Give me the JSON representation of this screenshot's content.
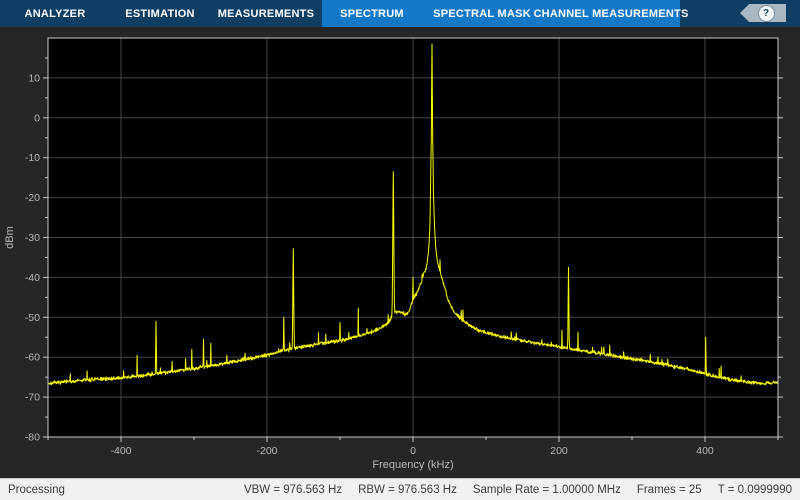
{
  "toolbar": {
    "tabs": [
      {
        "label": "ANALYZER",
        "selected": false
      },
      {
        "label": "ESTIMATION",
        "selected": false
      },
      {
        "label": "MEASUREMENTS",
        "selected": false
      },
      {
        "label": "SPECTRUM",
        "selected": true
      },
      {
        "label": "SPECTRAL MASK",
        "selected": true
      },
      {
        "label": "CHANNEL MEASUREMENTS",
        "selected": true
      }
    ],
    "help_icon_glyph": "?"
  },
  "statusbar": {
    "left": "Processing",
    "metrics": [
      "VBW = 976.563 Hz",
      "RBW = 976.563 Hz",
      "Sample Rate = 1.00000 MHz",
      "Frames = 25",
      "T = 0.0999990"
    ]
  },
  "colors": {
    "accent_dark": "#0e3e64",
    "accent_light": "#1478c8",
    "figure_bg": "#262626",
    "plot_bg": "#000000",
    "grid": "#464646",
    "axis_line": "#c8c8c8",
    "tick_text": "#b8b8b8",
    "trace": "#ffff00",
    "statusbar_bg": "#f0f0f0"
  },
  "chart_data": {
    "type": "line",
    "title": "",
    "xlabel": "Frequency (kHz)",
    "ylabel": "dBm",
    "xlim": [
      -500,
      500
    ],
    "ylim": [
      -80,
      20
    ],
    "xticks_labeled": [
      -400,
      -200,
      0,
      200,
      400
    ],
    "xtick_minor_step_khz": 100,
    "yticks_labeled": [
      -80,
      -70,
      -60,
      -50,
      -40,
      -30,
      -20,
      -10,
      0,
      10
    ],
    "ytick_minor_step_db": 5,
    "grid": true,
    "legend": "none",
    "noise_jitter_db": 0.7,
    "floor_points": [
      [
        -500,
        -66.6
      ],
      [
        -480,
        -66.2
      ],
      [
        -460,
        -65.9
      ],
      [
        -440,
        -65.6
      ],
      [
        -420,
        -65.4
      ],
      [
        -400,
        -65.2
      ],
      [
        -380,
        -64.8
      ],
      [
        -360,
        -64.3
      ],
      [
        -340,
        -63.8
      ],
      [
        -320,
        -63.3
      ],
      [
        -300,
        -62.8
      ],
      [
        -280,
        -62.2
      ],
      [
        -260,
        -61.6
      ],
      [
        -240,
        -60.9
      ],
      [
        -220,
        -60.2
      ],
      [
        -200,
        -59.4
      ],
      [
        -185,
        -58.7
      ],
      [
        -170,
        -58.1
      ],
      [
        -155,
        -57.5
      ],
      [
        -140,
        -57.0
      ],
      [
        -125,
        -56.5
      ],
      [
        -110,
        -56.1
      ],
      [
        -95,
        -55.6
      ],
      [
        -82,
        -55.1
      ],
      [
        -70,
        -54.5
      ],
      [
        -60,
        -53.9
      ],
      [
        -52,
        -53.3
      ],
      [
        -45,
        -52.7
      ],
      [
        -40,
        -52.2
      ],
      [
        -36,
        -51.6
      ],
      [
        -33,
        -51.0
      ],
      [
        -31,
        -50.4
      ],
      [
        -29,
        -49.6
      ],
      [
        -27,
        -48.9
      ],
      [
        -25,
        -48.7
      ],
      [
        -22,
        -48.6
      ],
      [
        -19,
        -48.7
      ],
      [
        -16,
        -48.9
      ],
      [
        -13,
        -49.1
      ],
      [
        -10,
        -49.2
      ],
      [
        -8,
        -48.9
      ],
      [
        -6,
        -48.4
      ],
      [
        -4,
        -47.6
      ],
      [
        -2,
        -46.5
      ],
      [
        0,
        -45.8
      ],
      [
        2,
        -44.9
      ],
      [
        4,
        -44.3
      ],
      [
        6,
        -43.6
      ],
      [
        8,
        -42.8
      ],
      [
        10,
        -41.8
      ],
      [
        12,
        -40.8
      ],
      [
        14,
        -39.5
      ],
      [
        16,
        -38.3
      ],
      [
        18,
        -37.6
      ],
      [
        20,
        -35.5
      ],
      [
        21.5,
        -33
      ],
      [
        23,
        -28
      ],
      [
        24,
        -18
      ],
      [
        25,
        -5
      ],
      [
        25.7,
        10
      ],
      [
        26,
        18.5
      ],
      [
        26.4,
        10
      ],
      [
        27,
        -5
      ],
      [
        28,
        -18
      ],
      [
        29,
        -25
      ],
      [
        30,
        -29
      ],
      [
        31,
        -32
      ],
      [
        32,
        -34
      ],
      [
        34,
        -36.5
      ],
      [
        37,
        -38.5
      ],
      [
        40,
        -40.5
      ],
      [
        44,
        -43
      ],
      [
        48,
        -45.5
      ],
      [
        52,
        -47.3
      ],
      [
        57,
        -48.8
      ],
      [
        64,
        -50
      ],
      [
        72,
        -51.3
      ],
      [
        80,
        -52.3
      ],
      [
        90,
        -53.2
      ],
      [
        100,
        -53.8
      ],
      [
        115,
        -54.6
      ],
      [
        130,
        -55.2
      ],
      [
        147,
        -55.7
      ],
      [
        160,
        -56.2
      ],
      [
        175,
        -56.7
      ],
      [
        190,
        -57.1
      ],
      [
        205,
        -57.5
      ],
      [
        220,
        -58
      ],
      [
        240,
        -58.6
      ],
      [
        260,
        -59.2
      ],
      [
        280,
        -59.8
      ],
      [
        300,
        -60.4
      ],
      [
        320,
        -61
      ],
      [
        340,
        -61.7
      ],
      [
        360,
        -62.4
      ],
      [
        380,
        -63.2
      ],
      [
        400,
        -64.2
      ],
      [
        420,
        -65
      ],
      [
        440,
        -65.7
      ],
      [
        460,
        -66.2
      ],
      [
        480,
        -66.6
      ],
      [
        500,
        -66.4
      ]
    ],
    "spikes": [
      [
        -378,
        -59.5,
        12
      ],
      [
        -352,
        -51,
        14
      ],
      [
        -330,
        -61,
        12
      ],
      [
        -303,
        -58,
        12
      ],
      [
        -287,
        -55.5,
        12
      ],
      [
        -277,
        -56.5,
        12
      ],
      [
        -255,
        -59.5,
        12
      ],
      [
        -230,
        -59,
        12
      ],
      [
        -177,
        -50,
        14
      ],
      [
        -164,
        -32.8,
        18
      ],
      [
        -100,
        -51.3,
        14
      ],
      [
        -88,
        -53.8,
        12
      ],
      [
        -75,
        -47.7,
        14
      ],
      [
        -63,
        -52.8,
        12
      ],
      [
        -27,
        -13.5,
        22
      ],
      [
        0,
        -40,
        16
      ],
      [
        26,
        18.5,
        30
      ],
      [
        204,
        -53.2,
        12
      ],
      [
        213,
        -37.5,
        18
      ],
      [
        226,
        -53.7,
        12
      ],
      [
        246,
        -57.5,
        12
      ],
      [
        325,
        -59.3,
        12
      ],
      [
        341,
        -60.5,
        12
      ],
      [
        401,
        -55,
        14
      ]
    ]
  }
}
